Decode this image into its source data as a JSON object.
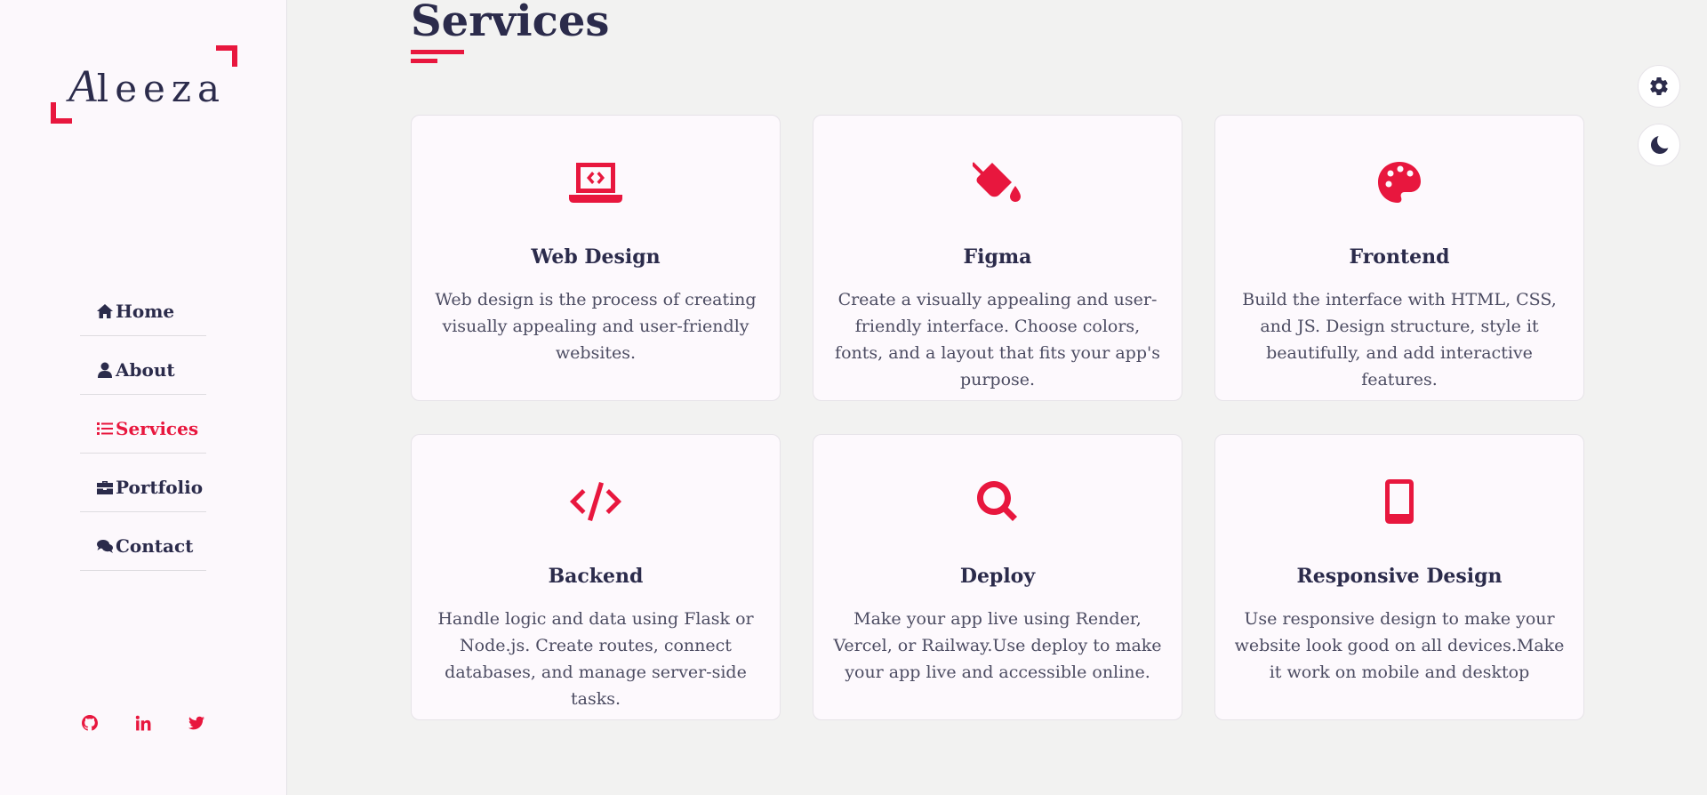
{
  "brand": {
    "logo_first": "A",
    "logo_rest": "leeza"
  },
  "nav": {
    "items": [
      {
        "label": "Home",
        "icon": "home-icon"
      },
      {
        "label": "About",
        "icon": "user-icon"
      },
      {
        "label": "Services",
        "icon": "list-icon",
        "active": true
      },
      {
        "label": "Portfolio",
        "icon": "briefcase-icon"
      },
      {
        "label": "Contact",
        "icon": "comments-icon"
      }
    ]
  },
  "socials": [
    "github-icon",
    "linkedin-icon",
    "twitter-icon"
  ],
  "page": {
    "title": "Services"
  },
  "services": [
    {
      "title": "Web Design",
      "text": "Web design is the process of creating visually appealing and user-friendly websites.",
      "icon": "laptop-code-icon"
    },
    {
      "title": "Figma",
      "text": "Create a visually appealing and user-friendly interface. Choose colors, fonts, and a layout that fits your app's purpose.",
      "icon": "paint-bucket-icon"
    },
    {
      "title": "Frontend",
      "text": "Build the interface with HTML, CSS, and JS. Design structure, style it beautifully, and add interactive features.",
      "icon": "palette-icon"
    },
    {
      "title": "Backend",
      "text": "Handle logic and data using Flask or Node.js. Create routes, connect databases, and manage server-side tasks.",
      "icon": "code-icon"
    },
    {
      "title": "Deploy",
      "text": "Make your app live using Render, Vercel, or Railway.Use deploy to make your app live and accessible online.",
      "icon": "search-icon"
    },
    {
      "title": "Responsive Design",
      "text": "Use responsive design to make your website look good on all devices.Make it work on mobile and desktop",
      "icon": "mobile-icon"
    }
  ],
  "colors": {
    "accent": "#e8173e",
    "text": "#2b2b4b",
    "sidebar_bg": "#fcf8fc",
    "page_bg": "#f2f2f1"
  },
  "floating": [
    "settings-gear-icon",
    "dark-mode-moon-icon"
  ]
}
